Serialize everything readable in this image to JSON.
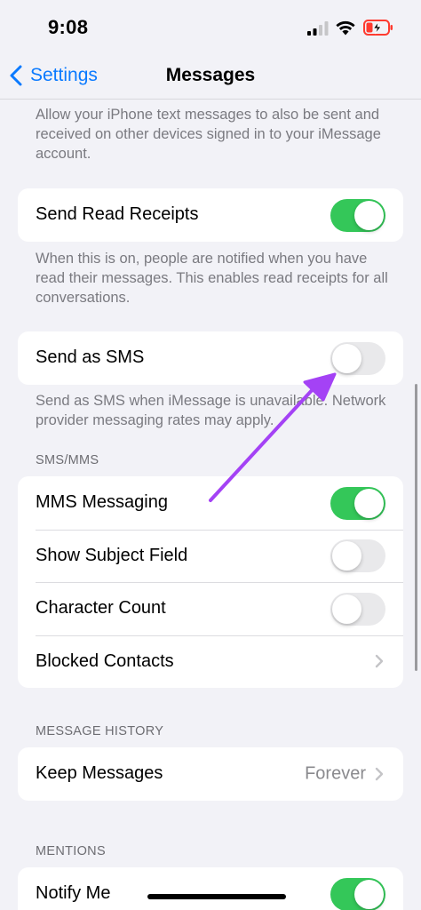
{
  "status_bar": {
    "time": "9:08"
  },
  "nav": {
    "back_label": "Settings",
    "title": "Messages"
  },
  "imessage_footer": "Allow your iPhone text messages to also be sent and received on other devices signed in to your iMessage account.",
  "read_receipts": {
    "label": "Send Read Receipts",
    "enabled": true,
    "footer": "When this is on, people are notified when you have read their messages. This enables read receipts for all conversations."
  },
  "send_as_sms": {
    "label": "Send as SMS",
    "enabled": false,
    "footer": "Send as SMS when iMessage is unavailable. Network provider messaging rates may apply."
  },
  "sms_mms": {
    "header": "SMS/MMS",
    "mms_messaging": {
      "label": "MMS Messaging",
      "enabled": true
    },
    "show_subject_field": {
      "label": "Show Subject Field",
      "enabled": false
    },
    "character_count": {
      "label": "Character Count",
      "enabled": false
    },
    "blocked_contacts": {
      "label": "Blocked Contacts"
    }
  },
  "message_history": {
    "header": "MESSAGE HISTORY",
    "keep_messages": {
      "label": "Keep Messages",
      "value": "Forever"
    }
  },
  "mentions": {
    "header": "MENTIONS",
    "notify_me": {
      "label": "Notify Me",
      "enabled": true
    }
  },
  "colors": {
    "accent_blue": "#0a7aff",
    "toggle_on": "#34c759",
    "toggle_off": "#e9e9eb",
    "annotation_arrow": "#a442f5",
    "battery_low": "#ff3b30"
  },
  "icons": [
    "signal-icon",
    "wifi-icon",
    "battery-charging-icon",
    "chevron-left-icon",
    "chevron-right-icon"
  ]
}
